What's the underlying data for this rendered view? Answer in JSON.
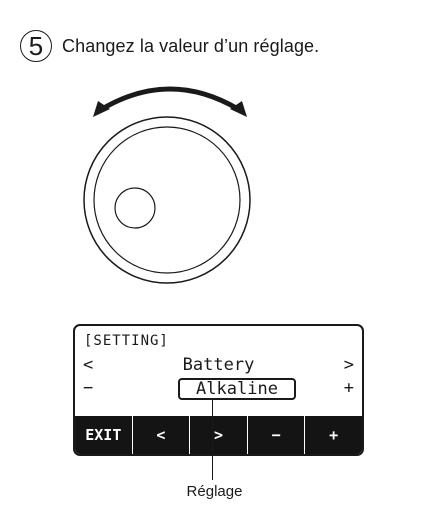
{
  "step": {
    "number": "5",
    "text": "Changez la valeur d’un réglage."
  },
  "dial": {
    "arrow_icon": "double-arrow-icon"
  },
  "lcd": {
    "header": "[SETTING]",
    "name": "Battery",
    "value": "Alkaline",
    "left_arrow": "<",
    "right_arrow": ">",
    "minus": "−",
    "plus": "+",
    "softkeys": [
      "EXIT",
      "<",
      ">",
      "−",
      "+"
    ]
  },
  "callout": {
    "label": "Réglage"
  }
}
